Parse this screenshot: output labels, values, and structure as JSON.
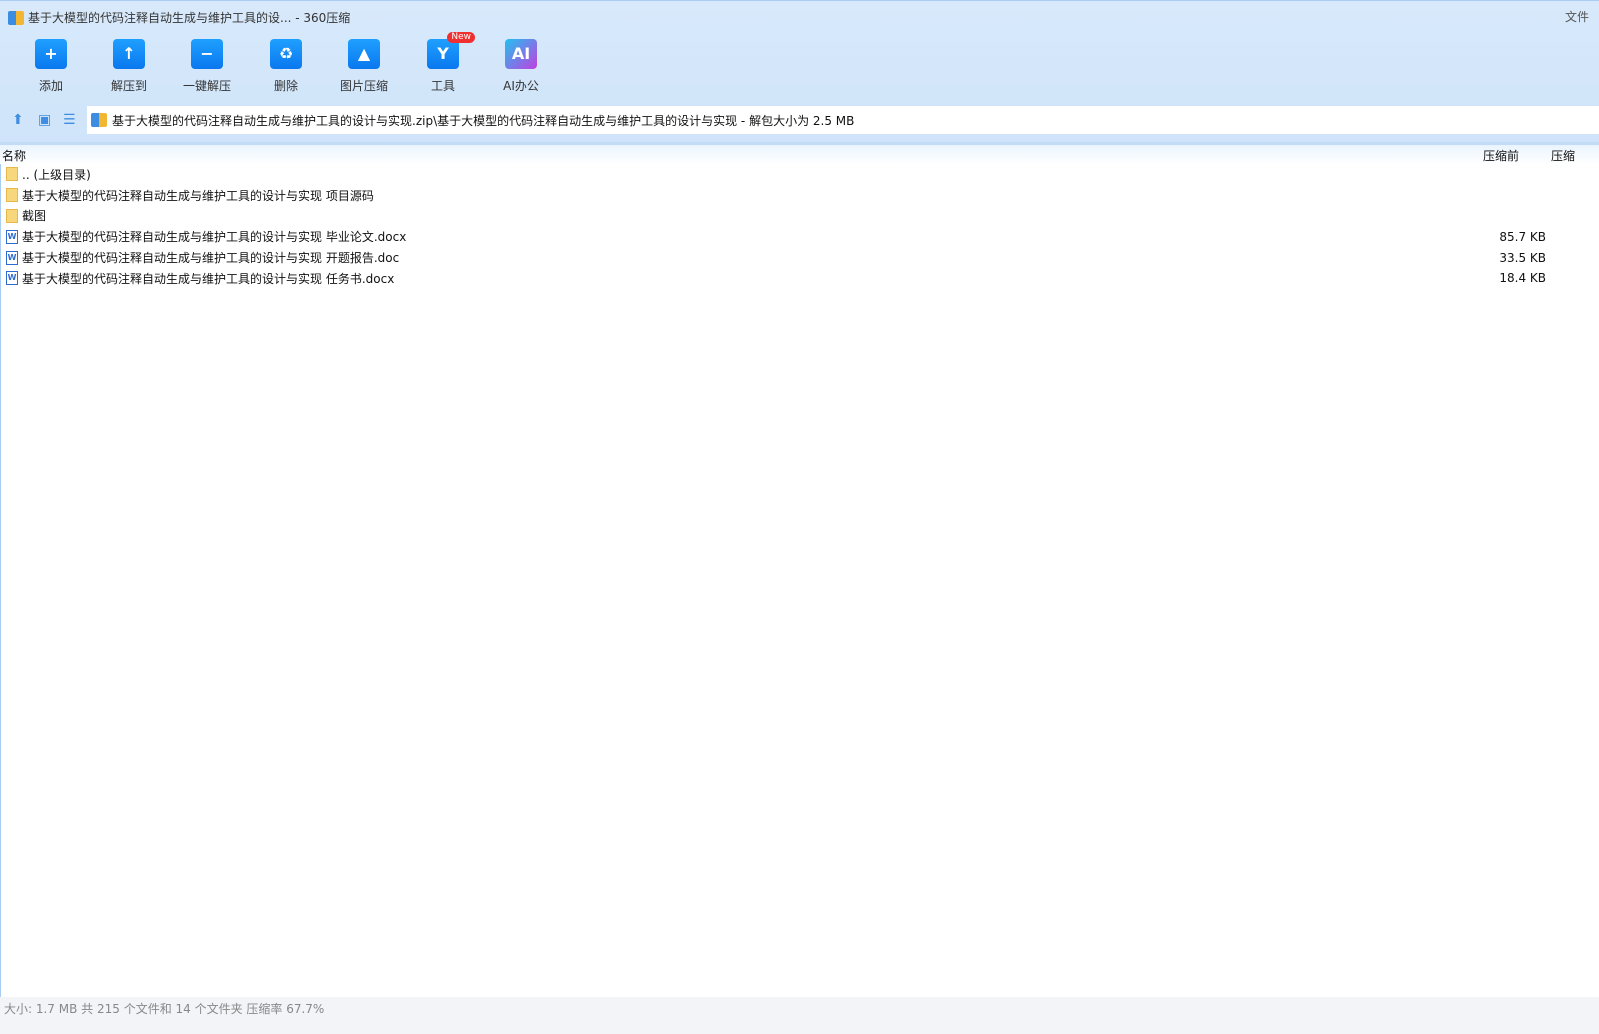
{
  "window": {
    "title": "基于大模型的代码注释自动生成与维护工具的设... - 360压缩",
    "file_menu": "文件"
  },
  "toolbar": [
    {
      "label": "添加",
      "icon": "+"
    },
    {
      "label": "解压到",
      "icon": "↑"
    },
    {
      "label": "一键解压",
      "icon": "−"
    },
    {
      "label": "删除",
      "icon": "♻"
    },
    {
      "label": "图片压缩",
      "icon": "▲"
    },
    {
      "label": "工具",
      "icon": "Y",
      "badge": "New"
    },
    {
      "label": "AI办公",
      "icon": "AI"
    }
  ],
  "address": {
    "path": "基于大模型的代码注释自动生成与维护工具的设计与实现.zip\\基于大模型的代码注释自动生成与维护工具的设计与实现 - 解包大小为 2.5 MB"
  },
  "columns": {
    "name": "名称",
    "original": "压缩前",
    "compressed": "压缩"
  },
  "rows": [
    {
      "name": ".. (上级目录)",
      "type": "folder",
      "size": ""
    },
    {
      "name": "基于大模型的代码注释自动生成与维护工具的设计与实现 项目源码",
      "type": "folder",
      "size": ""
    },
    {
      "name": "截图",
      "type": "folder",
      "size": ""
    },
    {
      "name": "基于大模型的代码注释自动生成与维护工具的设计与实现 毕业论文.docx",
      "type": "word",
      "size": "85.7 KB"
    },
    {
      "name": "基于大模型的代码注释自动生成与维护工具的设计与实现 开题报告.doc",
      "type": "word",
      "size": "33.5 KB"
    },
    {
      "name": "基于大模型的代码注释自动生成与维护工具的设计与实现 任务书.docx",
      "type": "word",
      "size": "18.4 KB"
    }
  ],
  "status": "大小: 1.7 MB 共 215 个文件和 14 个文件夹 压缩率 67.7%"
}
